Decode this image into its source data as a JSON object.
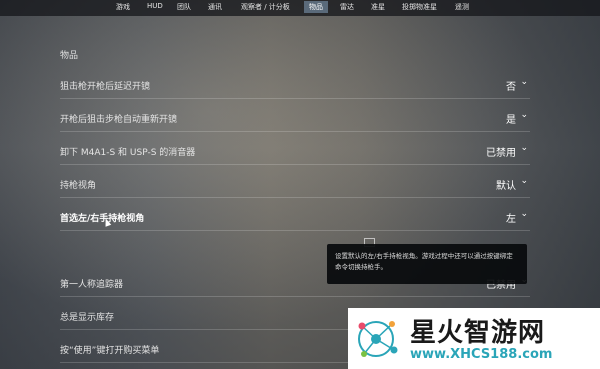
{
  "nav": {
    "tabs": [
      {
        "label": "游戏",
        "active": false
      },
      {
        "label": "HUD",
        "active": false
      },
      {
        "label": "团队",
        "active": false
      },
      {
        "label": "通讯",
        "active": false
      },
      {
        "label": "观察者 / 计分板",
        "active": false
      },
      {
        "label": "物品",
        "active": true
      },
      {
        "label": "雷达",
        "active": false
      },
      {
        "label": "准星",
        "active": false
      },
      {
        "label": "投掷物准星",
        "active": false
      },
      {
        "label": "遥测",
        "active": false
      }
    ]
  },
  "section": {
    "title": "物品"
  },
  "settings": [
    {
      "label": "狙击枪开枪后延迟开镜",
      "value": "否"
    },
    {
      "label": "开枪后狙击步枪自动重新开镜",
      "value": "是"
    },
    {
      "label": "卸下 M4A1-S 和 USP-S 的消音器",
      "value": "已禁用"
    },
    {
      "label": "持枪视角",
      "value": "默认"
    },
    {
      "label": "首选左/右手持枪视角",
      "value": "左"
    },
    {
      "label": "第一人称追踪器",
      "value": "已禁用"
    },
    {
      "label": "总是显示库存",
      "value": ""
    },
    {
      "label": "按“使用”键打开购买菜单",
      "value": ""
    }
  ],
  "tooltip": {
    "text": "设置默认的左/右手持枪视角。游戏过程中还可以通过按键绑定命令切换持枪手。"
  },
  "watermark": {
    "title": "星火智游网",
    "url": "www.XHCS188.com"
  },
  "colors": {
    "watermark_accent": "#2aa5b8",
    "active_tab": "#5a6a7a"
  }
}
